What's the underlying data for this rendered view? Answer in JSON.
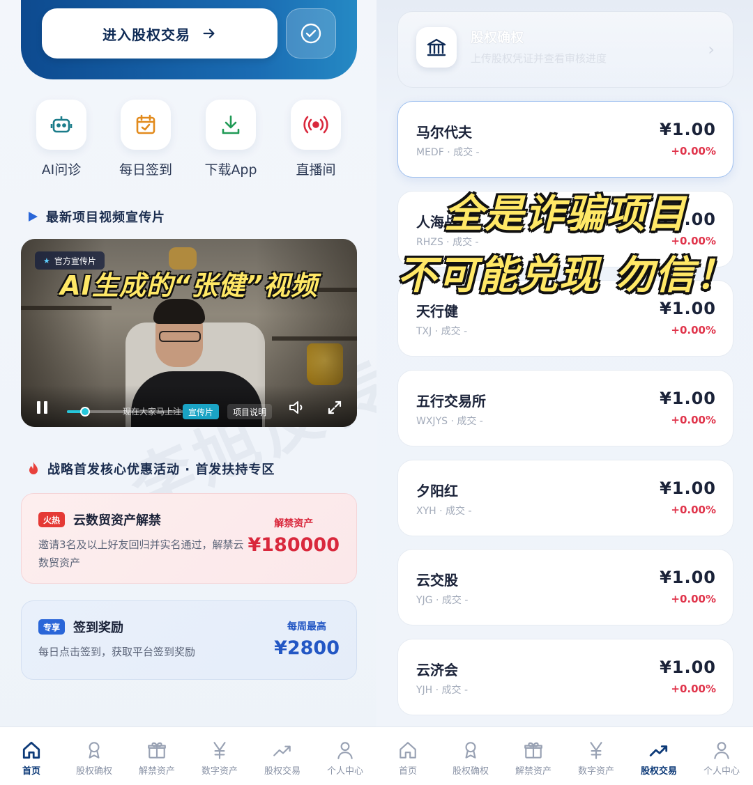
{
  "left": {
    "enter_button": "进入股权交易",
    "quick_actions": [
      {
        "label": "AI问诊",
        "icon": "robot-icon"
      },
      {
        "label": "每日签到",
        "icon": "calendar-check-icon"
      },
      {
        "label": "下载App",
        "icon": "download-icon"
      },
      {
        "label": "直播间",
        "icon": "broadcast-icon"
      }
    ],
    "video_section_title": "最新项目视频宣传片",
    "video": {
      "official_tag": "官方宣传片",
      "caption": "AI生成的“张健”视频",
      "subtitle": "现在大家马上注",
      "chip_promo": "宣传片",
      "chip_desc": "项目说明",
      "progress_fraction": 0.15
    },
    "activity_section_title": "战略首发核心优惠活动 · 首发扶持专区",
    "promos": [
      {
        "badge": "火热",
        "title": "云数贸资产解禁",
        "desc": "邀请3名及以上好友回归并实名通过，解禁云数贸资产",
        "right_label": "解禁资产",
        "right_value": "¥180000"
      },
      {
        "badge": "专享",
        "title": "签到奖励",
        "desc": "每日点击签到，获取平台签到奖励",
        "right_label": "每周最高",
        "right_value": "¥2800"
      }
    ],
    "watermark": "李旭反传防骗团队"
  },
  "tabs": [
    {
      "label": "首页",
      "icon": "home-icon"
    },
    {
      "label": "股权确权",
      "icon": "award-icon"
    },
    {
      "label": "解禁资产",
      "icon": "gift-icon"
    },
    {
      "label": "数字资产",
      "icon": "yen-icon"
    },
    {
      "label": "股权交易",
      "icon": "trend-icon"
    },
    {
      "label": "个人中心",
      "icon": "user-icon"
    }
  ],
  "left_active_tab": "首页",
  "right_active_tab": "股权交易",
  "right": {
    "header_title": "股权确权",
    "header_subtitle": "上传股权凭证并查看审核进度",
    "stocks": [
      {
        "name": "马尔代夫",
        "meta": "MEDF · 成交 -",
        "price": "¥1.00",
        "change": "+0.00%"
      },
      {
        "name": "人海战",
        "meta": "RHZS · 成交 -",
        "price": "¥1.00",
        "change": "+0.00%"
      },
      {
        "name": "天行健",
        "meta": "TXJ · 成交 -",
        "price": "¥1.00",
        "change": "+0.00%"
      },
      {
        "name": "五行交易所",
        "meta": "WXJYS · 成交 -",
        "price": "¥1.00",
        "change": "+0.00%"
      },
      {
        "name": "夕阳红",
        "meta": "XYH · 成交 -",
        "price": "¥1.00",
        "change": "+0.00%"
      },
      {
        "name": "云交股",
        "meta": "YJG · 成交 -",
        "price": "¥1.00",
        "change": "+0.00%"
      },
      {
        "name": "云济会",
        "meta": "YJH · 成交 -",
        "price": "¥1.00",
        "change": "+0.00%"
      }
    ],
    "warning_line1": "全是诈骗项目",
    "warning_line2": "不可能兑现 勿信！"
  },
  "colors": {
    "brand_blue": "#0d4a8f",
    "price_up_red": "#e0344b",
    "caption_yellow": "#ffe866"
  }
}
